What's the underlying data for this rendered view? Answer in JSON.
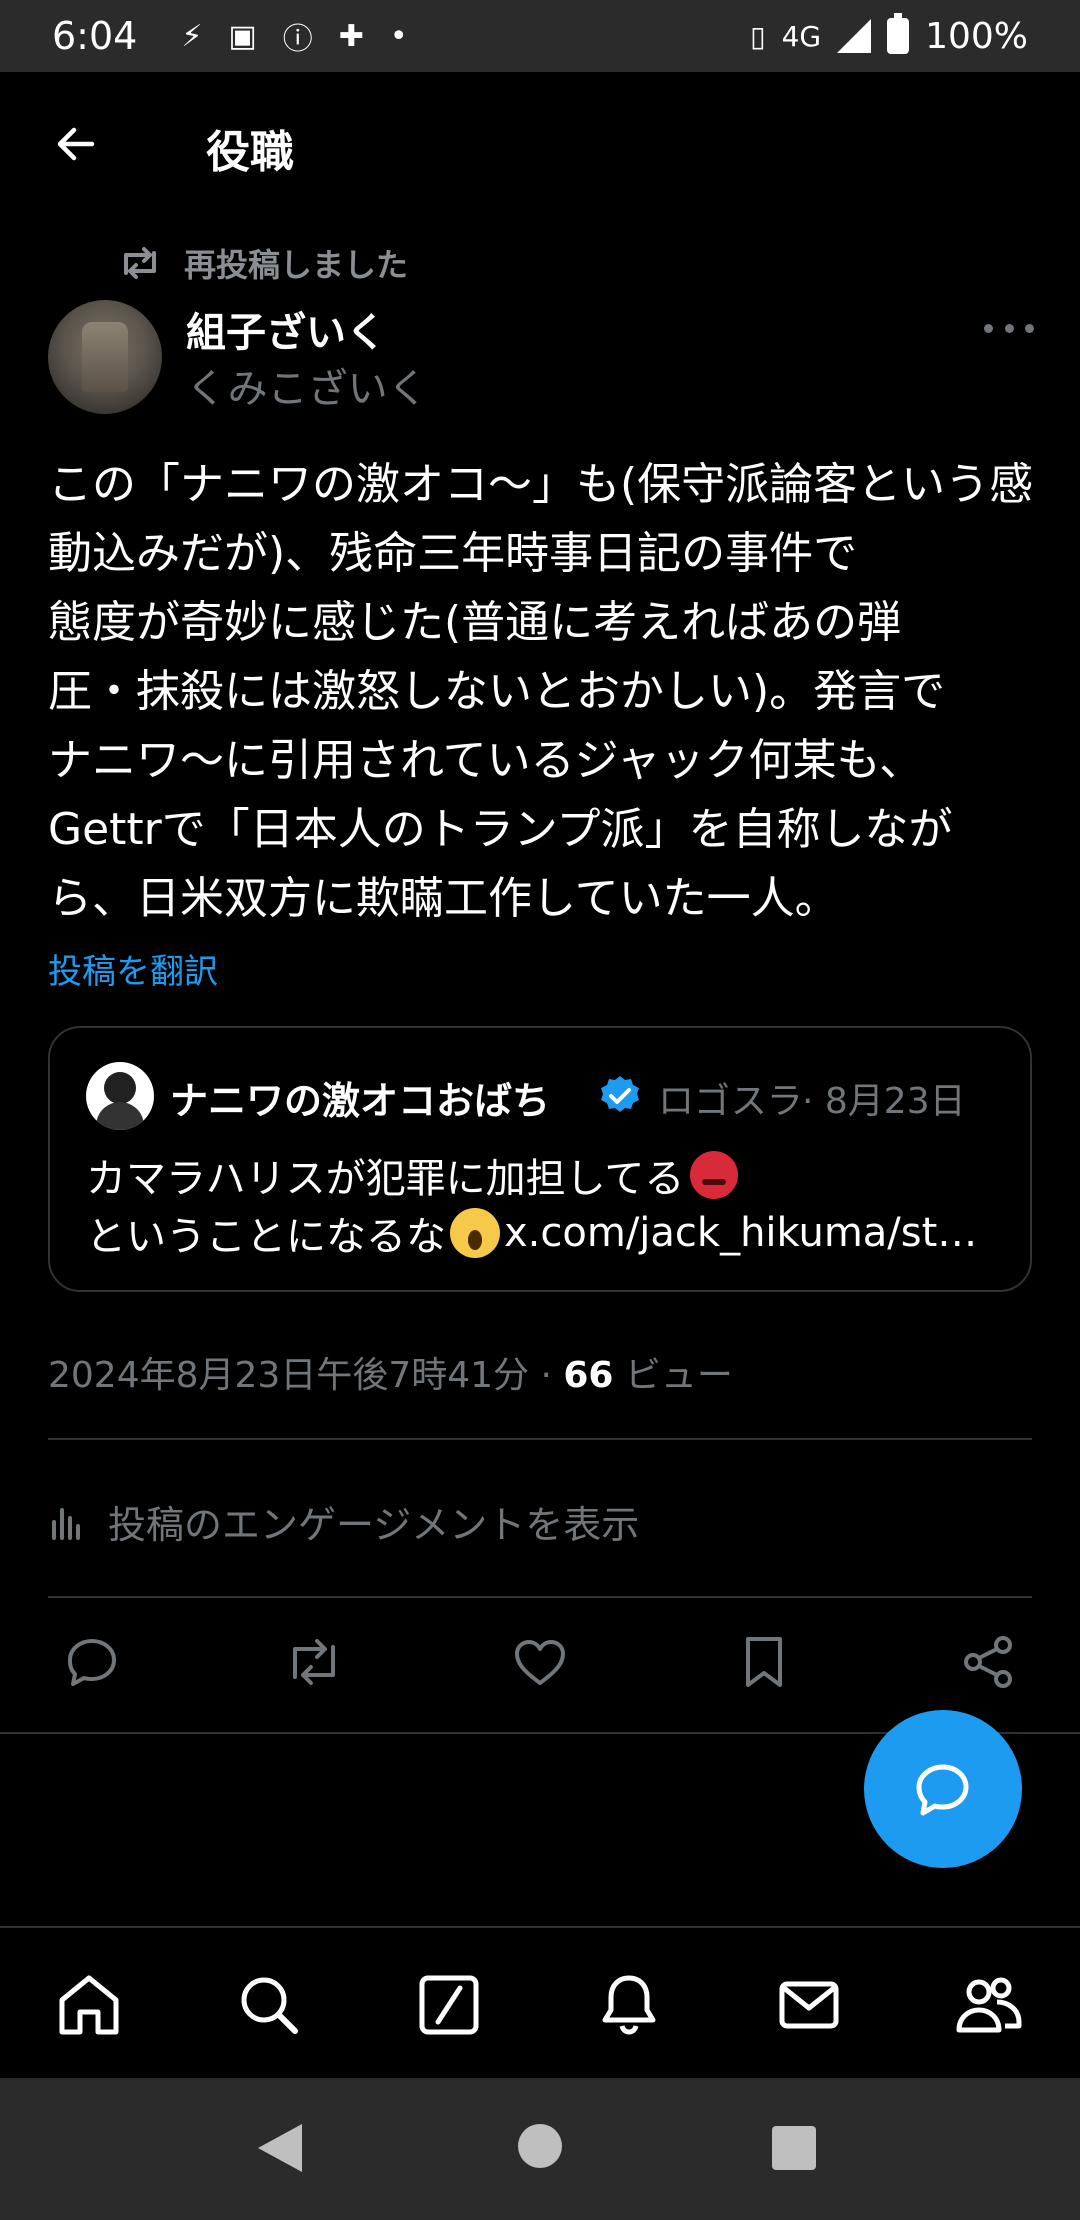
{
  "status_bar": {
    "time": "6:04",
    "network": "4G",
    "battery": "100%"
  },
  "header": {
    "title": "役職"
  },
  "post": {
    "repost_label": "再投稿しました",
    "author_name": "組子ざいく",
    "author_handle": "くみこざいく",
    "text": "この「ナニワの激オコ〜」も(保守派論客という感動込みだが)、残命三年時事日記の事件で\n態度が奇妙に感じた(普通に考えればあの弾\n圧・抹殺には激怒しないとおかしい)。発言で\nナニワ〜に引用されているジャック何某も、\nGettrで「日本人のトランプ派」を自称しなが\nら、日米双方に欺瞞工作していた一人。",
    "translate_label": "投稿を翻訳",
    "quote": {
      "name": "ナニワの激オコおばち",
      "handle": "ロゴスラ",
      "date": "· 8月23日",
      "line1": "カマラハリスが犯罪に加担してる",
      "line2_text": "ということになるな",
      "line2_link": "x.com/jack_hikuma/st…"
    },
    "timestamp": "2024年8月23日午後7時41分 · ",
    "views_count": "66",
    "views_label": " ビュー",
    "engagement_label": "投稿のエンゲージメントを表示"
  },
  "colors": {
    "accent": "#1d9bf0",
    "background": "#000000",
    "muted": "#71767b",
    "divider": "#2f3336"
  },
  "icons": {
    "back": "arrow-left-icon",
    "repost": "repost-icon",
    "reply": "reply-icon",
    "like": "heart-icon",
    "bookmark": "bookmark-icon",
    "share": "share-icon",
    "fab": "compose-reply-icon"
  }
}
